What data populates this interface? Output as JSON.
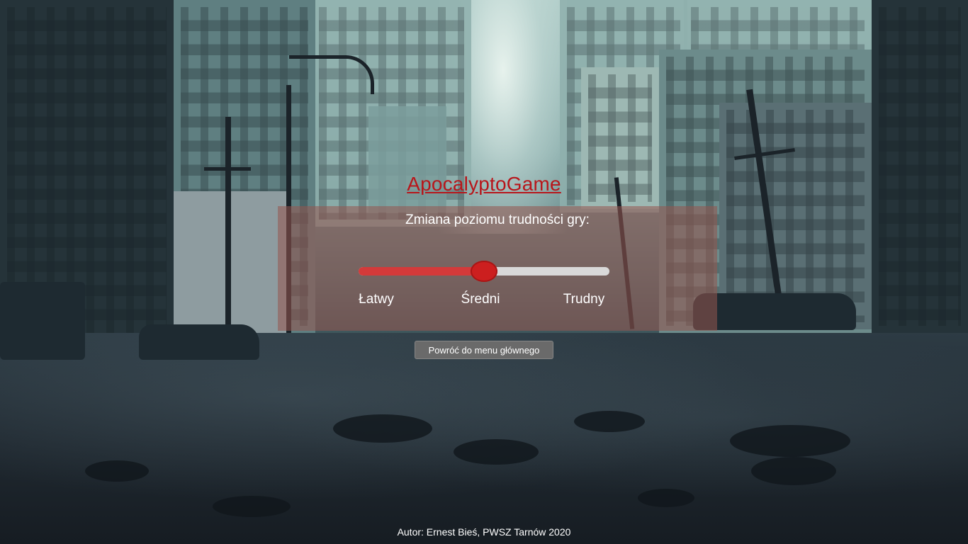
{
  "game": {
    "title": "ApocalyptoGame"
  },
  "difficulty": {
    "heading": "Zmiana poziomu trudności gry:",
    "levels": [
      "Łatwy",
      "Średni",
      "Trudny"
    ],
    "selected_level": "Średni",
    "slider_value_fraction": 0.5,
    "colors": {
      "panel": "#96554e",
      "fill": "#d43a3a",
      "thumb": "#cc1f1f",
      "track": "#d9d9d9",
      "title": "#b8161b"
    }
  },
  "back_button": {
    "label": "Powróć do menu głównego"
  },
  "footer": {
    "credit": "Autor: Ernest Bieś, PWSZ Tarnów 2020"
  },
  "background": {
    "scene": "post-apocalyptic-city-street"
  }
}
